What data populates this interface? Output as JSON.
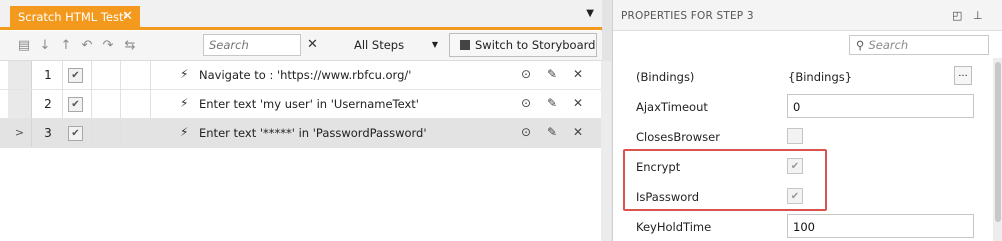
{
  "document_tab": {
    "title": "Scratch HTML Test*",
    "close_glyph": "✕"
  },
  "tab_menu_glyph": "▼",
  "toolbar": {
    "icons": [
      "step-group-icon",
      "move-down-icon",
      "move-up-icon",
      "undo-icon",
      "redo-icon",
      "branch-icon"
    ],
    "search_placeholder": "Search",
    "clear_glyph": "✕",
    "scope": {
      "selected": "All Steps"
    },
    "storyboard_button": "Switch to Storyboard"
  },
  "steps": [
    {
      "number": "1",
      "enabled": true,
      "description": "Navigate to : 'https://www.rbfcu.org/'",
      "selected": false
    },
    {
      "number": "2",
      "enabled": true,
      "description": "Enter text 'my user' in 'UsernameText'",
      "selected": false
    },
    {
      "number": "3",
      "enabled": true,
      "description": "Enter text '*****' in 'PasswordPassword'",
      "selected": true
    }
  ],
  "properties_panel": {
    "title": "PROPERTIES FOR STEP 3",
    "search_placeholder": "Search",
    "properties": [
      {
        "name": "(Bindings)",
        "type": "text",
        "value": "{Bindings}",
        "has_ellipsis": true
      },
      {
        "name": "AjaxTimeout",
        "type": "input",
        "value": "0"
      },
      {
        "name": "ClosesBrowser",
        "type": "checkbox",
        "checked": false
      },
      {
        "name": "Encrypt",
        "type": "checkbox",
        "checked": true
      },
      {
        "name": "IsPassword",
        "type": "checkbox",
        "checked": true
      },
      {
        "name": "KeyHoldTime",
        "type": "input",
        "value": "100"
      }
    ],
    "highlight_color": "#d9534f"
  },
  "colors": {
    "accent": "#f39a1e"
  }
}
